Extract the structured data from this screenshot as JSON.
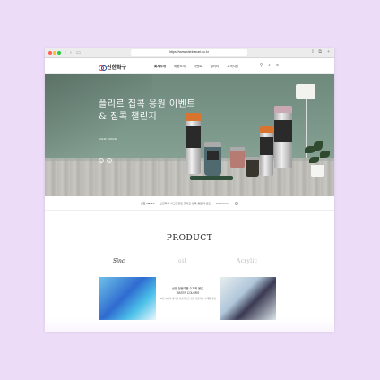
{
  "browser": {
    "url": "https://www.shinhanart.co.kr"
  },
  "header": {
    "logo_text": "신한화구",
    "menu": [
      "회사소개",
      "제품소개",
      "이벤트",
      "갤러리",
      "고객지원"
    ],
    "icons": [
      "user-icon",
      "search-icon",
      "menu-icon"
    ]
  },
  "hero": {
    "title_line1": "플리르 집콕 응원 이벤트",
    "title_line2": "& 집콕 챌린지",
    "view_more": "VIEW MORE",
    "colors": {
      "wall": "#7e9a8c",
      "floor": "#c6c4bf"
    }
  },
  "notice": {
    "label": "신한 NEWS",
    "text": "신한화구 아크릴물감 플리르 집콕 응원 이벤트",
    "date": "2020.04.03"
  },
  "product": {
    "title": "PRODUCT",
    "brands": [
      "Sinc",
      "oil",
      "Acrylic"
    ],
    "card_text": {
      "line1": "신한 전문가용 수채화 물감",
      "line2": "WATER COLORS",
      "line3": "30년 이상의 축적된 기술력으로 만든 전문가용 수채화 물감"
    }
  }
}
